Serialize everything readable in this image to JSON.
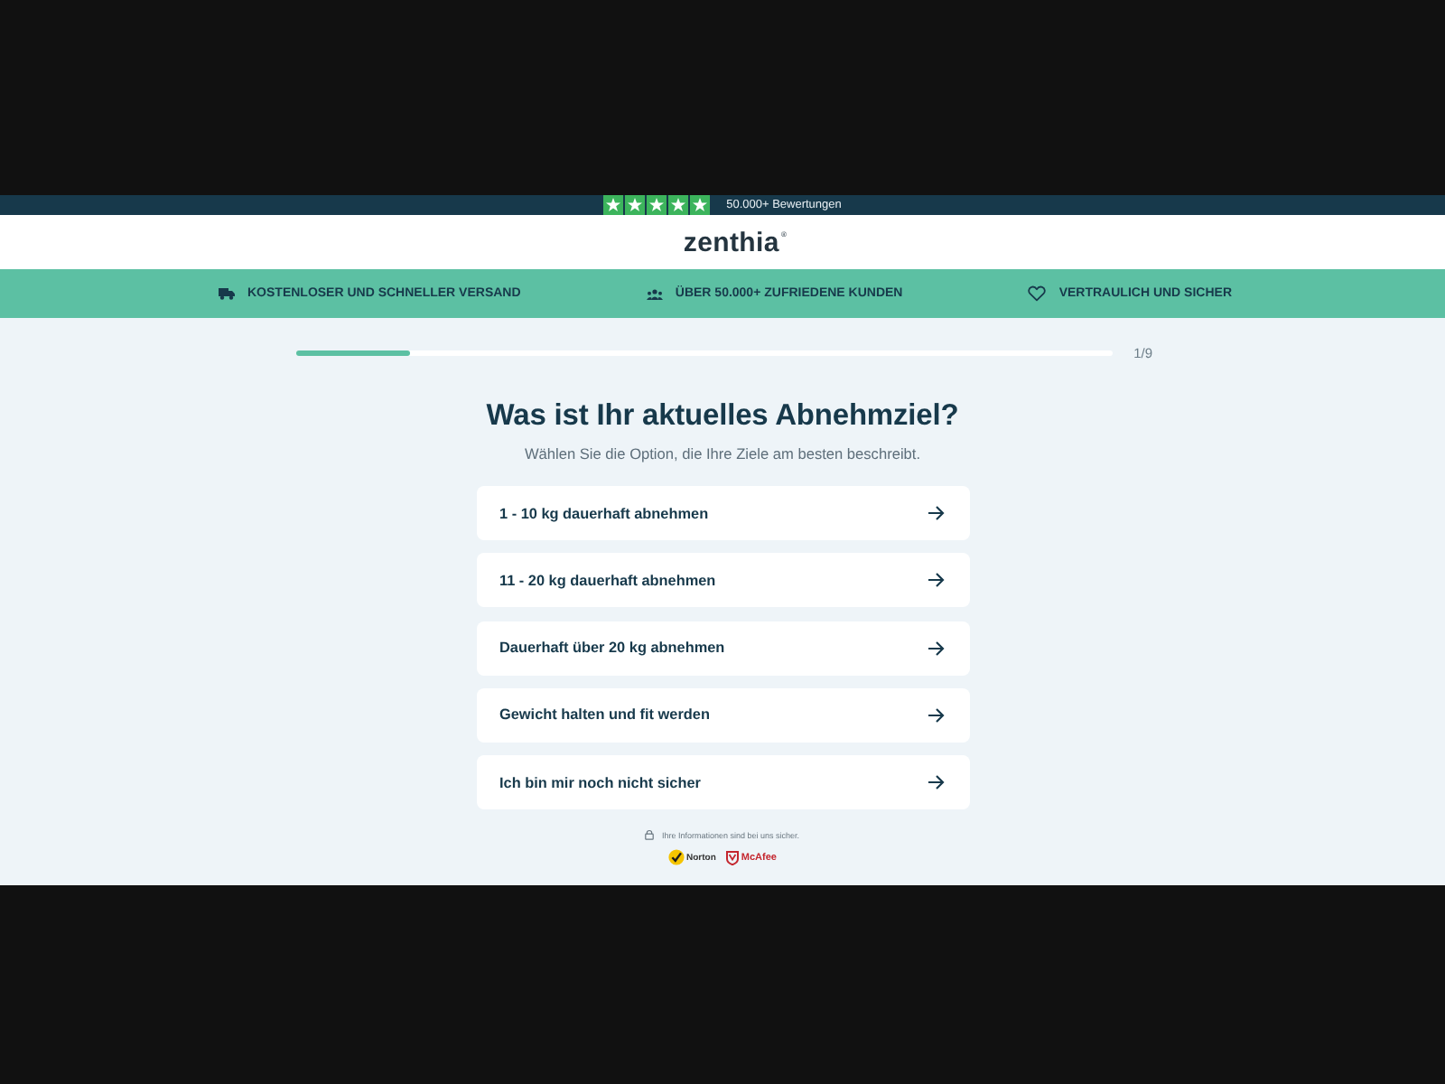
{
  "rating_bar": {
    "stars": 5,
    "text": "50.000+ Bewertungen"
  },
  "header": {
    "logo": "zenthia",
    "logo_mark": "®"
  },
  "benefits": [
    {
      "kind": "truck",
      "label": "KOSTENLOSER UND SCHNELLER VERSAND"
    },
    {
      "kind": "people",
      "label": "ÜBER 50.000+ ZUFRIEDENE KUNDEN"
    },
    {
      "kind": "heart",
      "label": "VERTRAULICH UND SICHER"
    }
  ],
  "progress": {
    "level": 0.14,
    "reading": "1/9"
  },
  "question": {
    "title": "Was ist Ihr aktuelles Abnehmziel?",
    "subtitle": "Wählen Sie die Option, die Ihre Ziele am besten beschreibt."
  },
  "options": [
    {
      "label": "1 - 10 kg dauerhaft abnehmen"
    },
    {
      "label": "11 - 20 kg dauerhaft abnehmen"
    },
    {
      "label": "Dauerhaft über 20 kg abnehmen"
    },
    {
      "label": "Gewicht halten und fit werden"
    },
    {
      "label": "Ich bin mir noch nicht sicher"
    }
  ],
  "security": {
    "note": "Ihre Informationen sind bei uns sicher.",
    "badges": [
      {
        "kind": "norton",
        "label": "Norton"
      },
      {
        "kind": "mcafee",
        "label": "McAfee"
      }
    ]
  }
}
